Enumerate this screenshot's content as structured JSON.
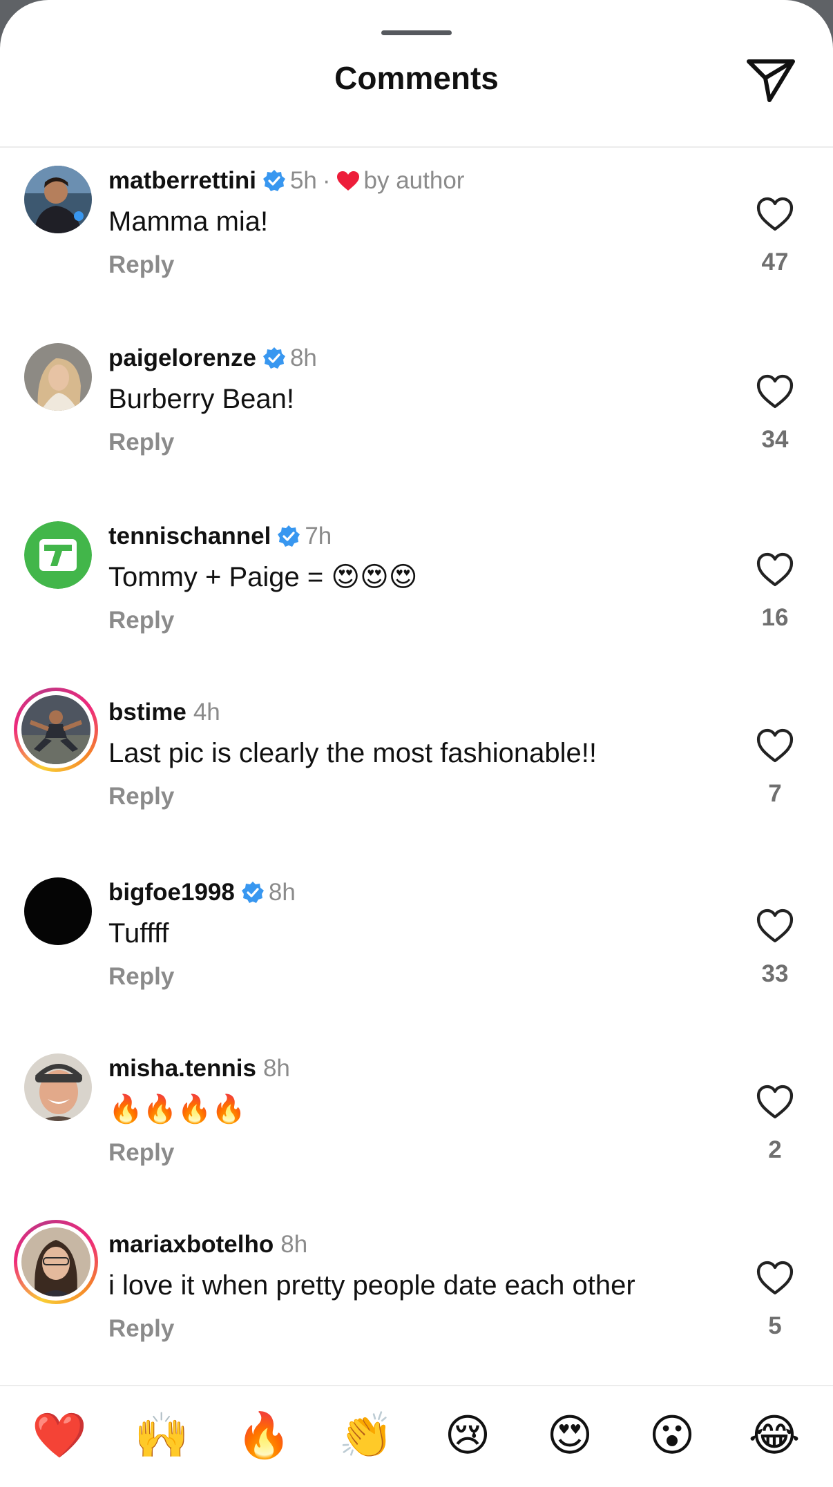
{
  "header": {
    "title": "Comments",
    "send_icon": "paper-plane-icon"
  },
  "colors": {
    "verified": "#3897f0",
    "author_heart": "#ed1d3a",
    "muted_text": "#8b8b8b",
    "story_ring": [
      "#f9ce34",
      "#ee2a7b",
      "#c13584"
    ]
  },
  "comments": [
    {
      "username": "matberrettini",
      "verified": true,
      "time": "5h",
      "author_liked": true,
      "liked_by_label": "by author",
      "text": "Mamma mia!",
      "reply_label": "Reply",
      "like_count": "47",
      "story_ring": false
    },
    {
      "username": "paigelorenze",
      "verified": true,
      "time": "8h",
      "text": "Burberry Bean!",
      "reply_label": "Reply",
      "like_count": "34",
      "story_ring": false
    },
    {
      "username": "tennischannel",
      "verified": true,
      "time": "7h",
      "text": "Tommy + Paige = 😍😍😍",
      "reply_label": "Reply",
      "like_count": "16",
      "story_ring": false
    },
    {
      "username": "bstime",
      "verified": false,
      "time": "4h",
      "text": "Last pic is clearly the most fashionable!!",
      "reply_label": "Reply",
      "like_count": "7",
      "story_ring": true
    },
    {
      "username": "bigfoe1998",
      "verified": true,
      "time": "8h",
      "text": "Tuffff",
      "reply_label": "Reply",
      "like_count": "33",
      "story_ring": false
    },
    {
      "username": "misha.tennis",
      "verified": false,
      "time": "8h",
      "text": "🔥🔥🔥🔥",
      "reply_label": "Reply",
      "like_count": "2",
      "story_ring": false
    },
    {
      "username": "mariaxbotelho",
      "verified": false,
      "time": "8h",
      "text": "i love it when pretty people date each other",
      "reply_label": "Reply",
      "like_count": "5",
      "story_ring": true
    }
  ],
  "quick_reactions": [
    "❤️",
    "🙌",
    "🔥",
    "👏",
    "😢",
    "😍",
    "😮",
    "😂"
  ]
}
